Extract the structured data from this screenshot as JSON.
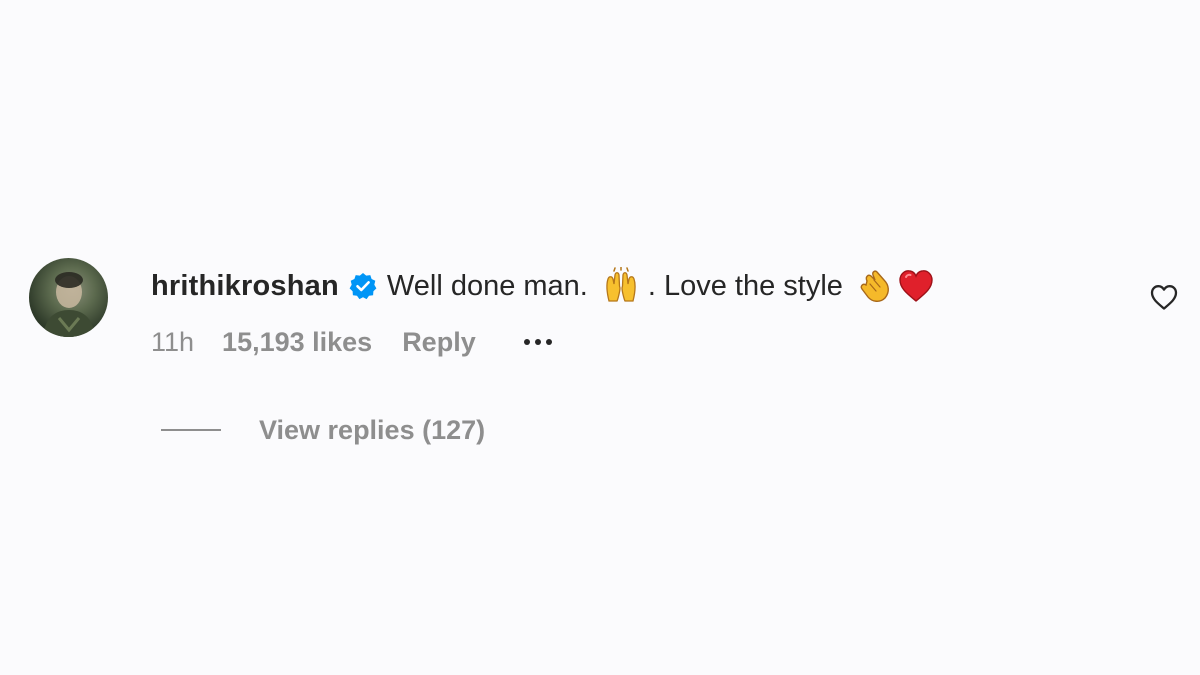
{
  "comment": {
    "username": "hrithikroshan",
    "verified": true,
    "verified_icon": "verified-badge-icon",
    "text_part1": "Well done man.",
    "emoji_1": "🙌",
    "emoji_1_name": "raising-hands-icon",
    "text_part2": ". Love the style",
    "emoji_2": "👏",
    "emoji_2_name": "clapping-hands-icon",
    "emoji_3": "❤️",
    "emoji_3_name": "red-heart-icon",
    "time": "11h",
    "likes": "15,193 likes",
    "reply_label": "Reply",
    "view_replies": "View replies (127)",
    "like_icon": "heart-outline-icon"
  },
  "colors": {
    "background": "#fbfbfd",
    "primary_text": "#262626",
    "secondary_text": "#8e8e8e",
    "verified_blue": "#0095f6",
    "heart_red": "#e0202b"
  }
}
